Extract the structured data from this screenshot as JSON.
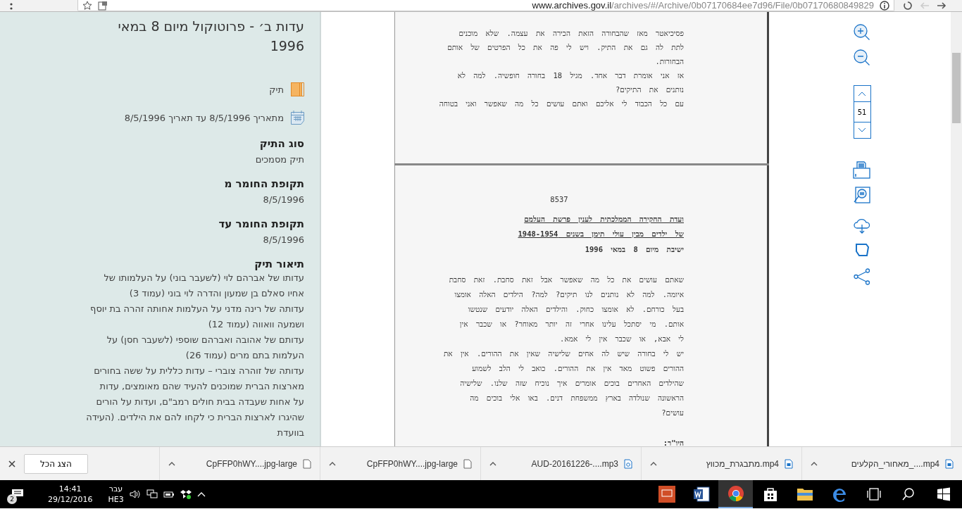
{
  "browser": {
    "url_host": "www.archives.gov.il",
    "url_path": "/archives/#/Archive/0b07170684ee7d96/File/0b07170680849829"
  },
  "sidebar": {
    "title": "עדות ב׳ - פרוטוקול מיום 8 במאי 1996",
    "type_label": "תיק",
    "date_range": "מתאריך 8/5/1996 עד תאריך 8/5/1996",
    "fields": [
      {
        "label": "סוג התיק",
        "value": "תיק מסמכים"
      },
      {
        "label": "תקופת החומר מ",
        "value": "8/5/1996"
      },
      {
        "label": "תקופת החומר עד",
        "value": "8/5/1996"
      }
    ],
    "description": {
      "label": "תיאור תיק",
      "paragraphs": [
        "עדותו של אברהם לוי (לשעבר בוני) על העלמותו של אחיו סאלם בן שמעון והדרה לוי בוני (עמוד 3)",
        "עדותה של רינה מדני על העלמות אחותה זהרה בת יוסף ושמעה וואווה (עמוד 12)",
        "עדותם של אהובה ואברהם שוספי (לשעבר חסן) על העלמות בתם מרים (עמוד 26)",
        "עדותה של זוהרה צוברי – עדות כללית על ששה בחורים מארצות הברית שמוכנים להעיד שהם מאומצים, עדות על אחות שעבדה בבית חולים רמב\"ם, ועדות על הורים שהיגרו לארצות הברית כי לקחו להם את הילדים. (העידה בוועדת"
      ]
    }
  },
  "viewer": {
    "pages": [
      {
        "lines": [
          {
            "kind": "body",
            "text": "פסיכיאטר מאז שהבחורה הזאת הכירה את עצמה. שלא מוכנים"
          },
          {
            "kind": "body",
            "text": "לתת לה גם את התיק. ויש לי פה את כל הפרטים של אותם"
          },
          {
            "kind": "body",
            "text": "הבחורות."
          },
          {
            "kind": "body",
            "text": "אז אני אומרת דבר אחד. מגיל 18 בחורה חופשיה. למה לא"
          },
          {
            "kind": "body",
            "text": "נותנים את התיקים?"
          },
          {
            "kind": "body",
            "text": "עם כל הכבוד לי אליכם ואתם עושים כל מה שאפשר ואני בטוחה"
          }
        ]
      },
      {
        "lines": [
          {
            "kind": "number",
            "text": "8537"
          },
          {
            "kind": "heading",
            "text": "ועדת החקירה הממלכתית לענין פרשת העלמם"
          },
          {
            "kind": "heading",
            "text": "של ילדים מבין עולי תימן בשנים 1948-1954"
          },
          {
            "kind": "subheading",
            "text": "ישיבת מיום 8 במאי 1996"
          },
          {
            "kind": "gap"
          },
          {
            "kind": "body",
            "text": "שאתם עושים את כל מה שאפשר אבל זאת סחבת. זאת סחבת"
          },
          {
            "kind": "body",
            "text": "איומה. למה לא נותנים לנו תיקים? למה? הילדים האלה אומצו"
          },
          {
            "kind": "body",
            "text": "בעל כורחם. לא אומצו כחוק. והילדים האלה יודעים שנטשו"
          },
          {
            "kind": "body",
            "text": "אותם. מי יסתכל עלינו אחרי זה יותר מאוחר? או שכבר אין"
          },
          {
            "kind": "body",
            "text": "לי אבא, או שכבר אין לי אמא."
          },
          {
            "kind": "body",
            "text": "יש לי בחורה שיש לה אחים שלישיה שאין את ההורים. אין את"
          },
          {
            "kind": "body",
            "text": "ההורים פשוט מאד אין את ההורים. כואב לי הלב לשמוע"
          },
          {
            "kind": "body",
            "text": "שהילדים האחרים בוכים אומרים איך נוכיח שזה שלנו. שלישיה"
          },
          {
            "kind": "body",
            "text": "הראשונה שנולדה בארץ ממשפחת דנים. באו אלי בוכים מה"
          },
          {
            "kind": "body",
            "text": "עושים?"
          },
          {
            "kind": "gap"
          },
          {
            "kind": "speaker",
            "text": "היו\"ר:"
          }
        ]
      }
    ]
  },
  "toolbar": {
    "page_number": "51"
  },
  "downloads": {
    "items": [
      {
        "name": "מאחורי_הקלעים_....mp4",
        "kind": "video"
      },
      {
        "name": "מתבגרת_מכווץ.mp4",
        "kind": "video"
      },
      {
        "name": "AUD-20161226-....mp3",
        "kind": "audio"
      },
      {
        "name": "CpFFP0hWY....jpg-large",
        "kind": "file"
      },
      {
        "name": "CpFFP0hWY....jpg-large",
        "kind": "file"
      }
    ],
    "show_all": "הצג הכל"
  },
  "taskbar": {
    "notification_count": "2",
    "time": "14:41",
    "date": "29/12/2016",
    "language": "עבר",
    "keyboard": "HE3"
  }
}
